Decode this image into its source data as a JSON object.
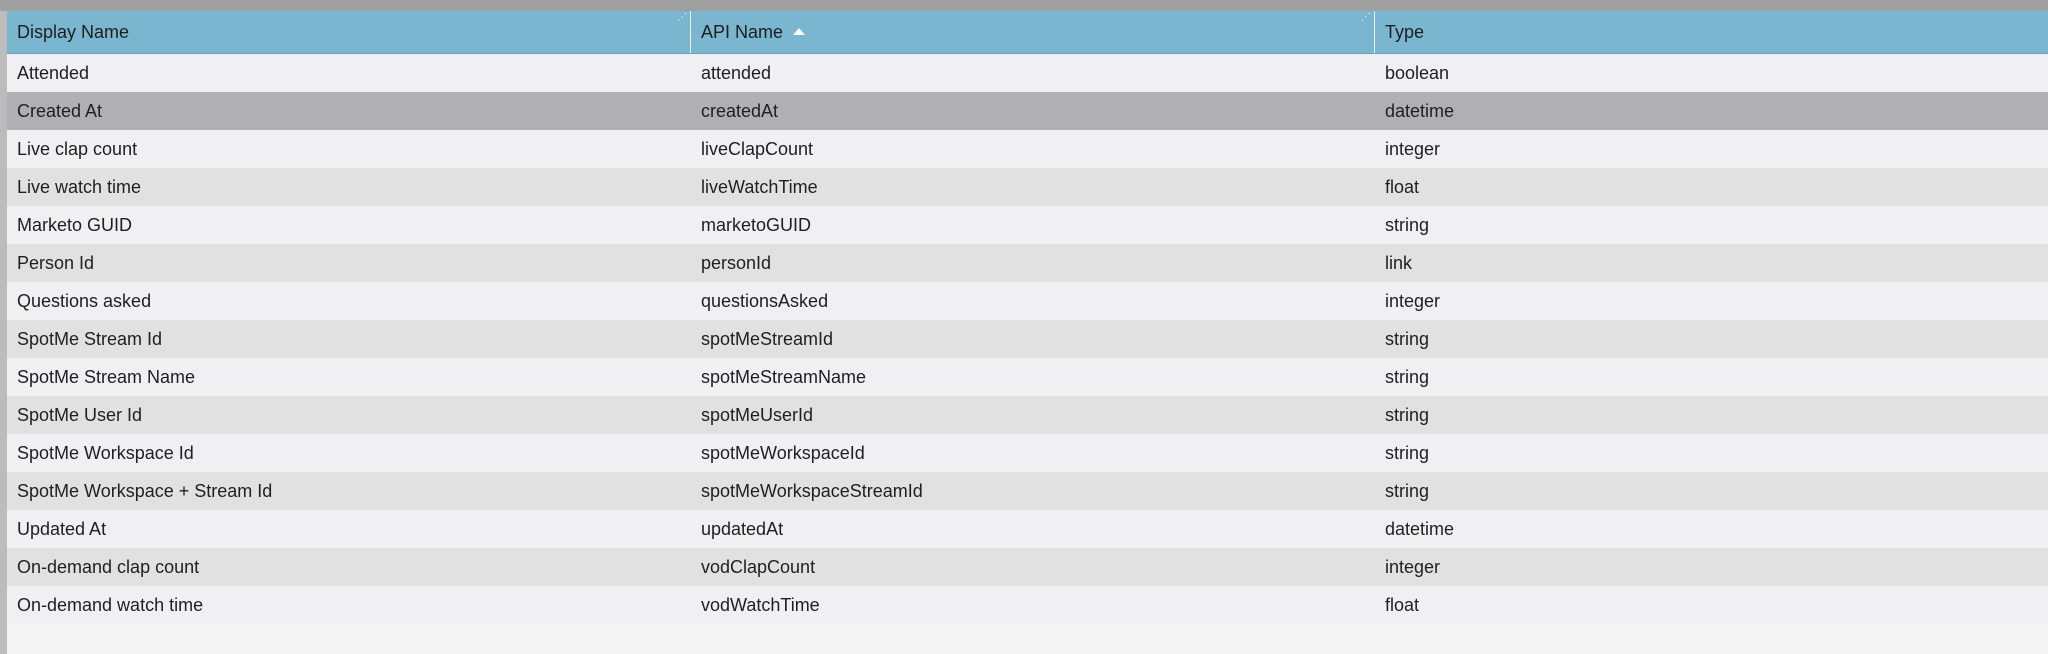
{
  "table": {
    "columns": [
      {
        "label": "Display Name"
      },
      {
        "label": "API Name",
        "sorted": "ascending"
      },
      {
        "label": "Type"
      }
    ],
    "selected_row": 1,
    "rows": [
      {
        "display_name": "Attended",
        "api_name": "attended",
        "type": "boolean"
      },
      {
        "display_name": "Created At",
        "api_name": "createdAt",
        "type": "datetime"
      },
      {
        "display_name": "Live clap count",
        "api_name": "liveClapCount",
        "type": "integer"
      },
      {
        "display_name": "Live watch time",
        "api_name": "liveWatchTime",
        "type": "float"
      },
      {
        "display_name": "Marketo GUID",
        "api_name": "marketoGUID",
        "type": "string"
      },
      {
        "display_name": "Person Id",
        "api_name": "personId",
        "type": "link"
      },
      {
        "display_name": "Questions asked",
        "api_name": "questionsAsked",
        "type": "integer"
      },
      {
        "display_name": "SpotMe Stream Id",
        "api_name": "spotMeStreamId",
        "type": "string"
      },
      {
        "display_name": "SpotMe Stream Name",
        "api_name": "spotMeStreamName",
        "type": "string"
      },
      {
        "display_name": "SpotMe User Id",
        "api_name": "spotMeUserId",
        "type": "string"
      },
      {
        "display_name": "SpotMe Workspace Id",
        "api_name": "spotMeWorkspaceId",
        "type": "string"
      },
      {
        "display_name": "SpotMe Workspace + Stream Id",
        "api_name": "spotMeWorkspaceStreamId",
        "type": "string"
      },
      {
        "display_name": "Updated At",
        "api_name": "updatedAt",
        "type": "datetime"
      },
      {
        "display_name": "On-demand clap count",
        "api_name": "vodClapCount",
        "type": "integer"
      },
      {
        "display_name": "On-demand watch time",
        "api_name": "vodWatchTime",
        "type": "float"
      }
    ]
  },
  "colors": {
    "header_bg": "#7ab6d0",
    "row_odd": "#f0f0f2",
    "row_even": "#e1e1e2",
    "row_selected": "#b0afb4"
  }
}
